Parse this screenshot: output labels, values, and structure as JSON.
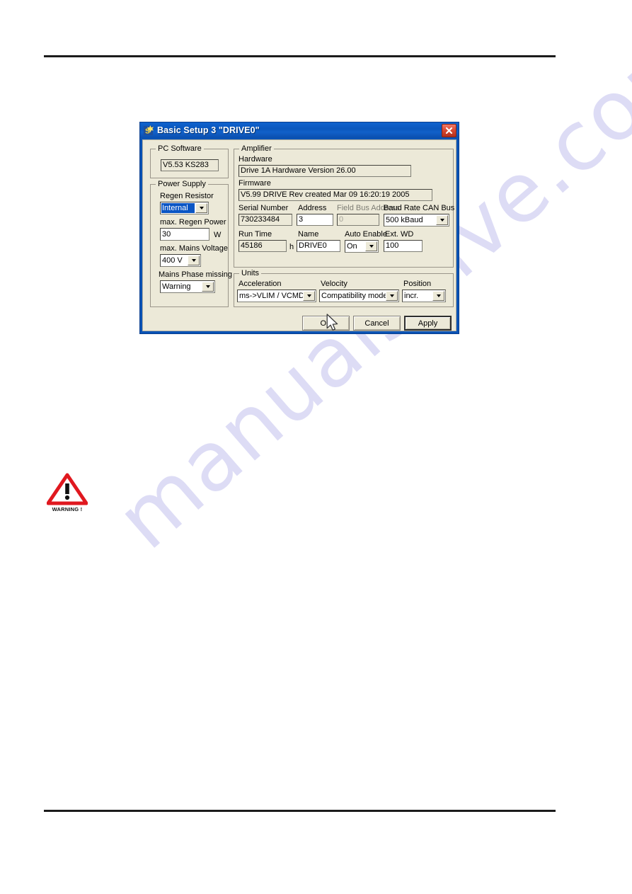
{
  "page": {
    "watermark": "manualshive.com"
  },
  "warning": {
    "icon": "warning-triangle-icon",
    "caption": "WARNING !"
  },
  "dialog": {
    "title": "Basic Setup 3 \"DRIVE0\"",
    "app_icon": "application-icon",
    "close_icon": "close-icon",
    "groups": {
      "pc_software": {
        "label": "PC Software",
        "version": "V5.53 KS283"
      },
      "power_supply": {
        "label": "Power Supply",
        "regen_resistor": {
          "label": "Regen Resistor",
          "value": "Internal"
        },
        "max_regen_power": {
          "label": "max. Regen Power",
          "value": "30",
          "unit": "W"
        },
        "max_mains_voltage": {
          "label": "max. Mains Voltage",
          "value": "400 V"
        },
        "mains_phase_missing": {
          "label": "Mains Phase missing",
          "value": "Warning"
        }
      },
      "amplifier": {
        "label": "Amplifier",
        "hardware": {
          "label": "Hardware",
          "value": "Drive 1A Hardware Version 26.00"
        },
        "firmware": {
          "label": "Firmware",
          "value": "V5.99 DRIVE Rev created Mar 09 16:20:19 2005"
        },
        "serial_number": {
          "label": "Serial Number",
          "value": "730233484"
        },
        "address": {
          "label": "Address",
          "value": "3"
        },
        "field_bus_address": {
          "label": "Field Bus Address",
          "value": "0"
        },
        "baud_rate_can_bus": {
          "label": "Baud Rate CAN Bus",
          "value": "500 kBaud"
        },
        "run_time": {
          "label": "Run Time",
          "value": "45186",
          "unit": "h"
        },
        "name": {
          "label": "Name",
          "value": "DRIVE0"
        },
        "auto_enable": {
          "label": "Auto Enable",
          "value": "On"
        },
        "ext_wd": {
          "label": "Ext. WD",
          "value": "100"
        }
      },
      "units": {
        "label": "Units",
        "acceleration": {
          "label": "Acceleration",
          "value": "ms->VLIM / VCMD"
        },
        "velocity": {
          "label": "Velocity",
          "value": "Compatibility mode"
        },
        "position": {
          "label": "Position",
          "value": "incr."
        }
      }
    },
    "buttons": {
      "ok": "OK",
      "cancel": "Cancel",
      "apply": "Apply"
    }
  }
}
